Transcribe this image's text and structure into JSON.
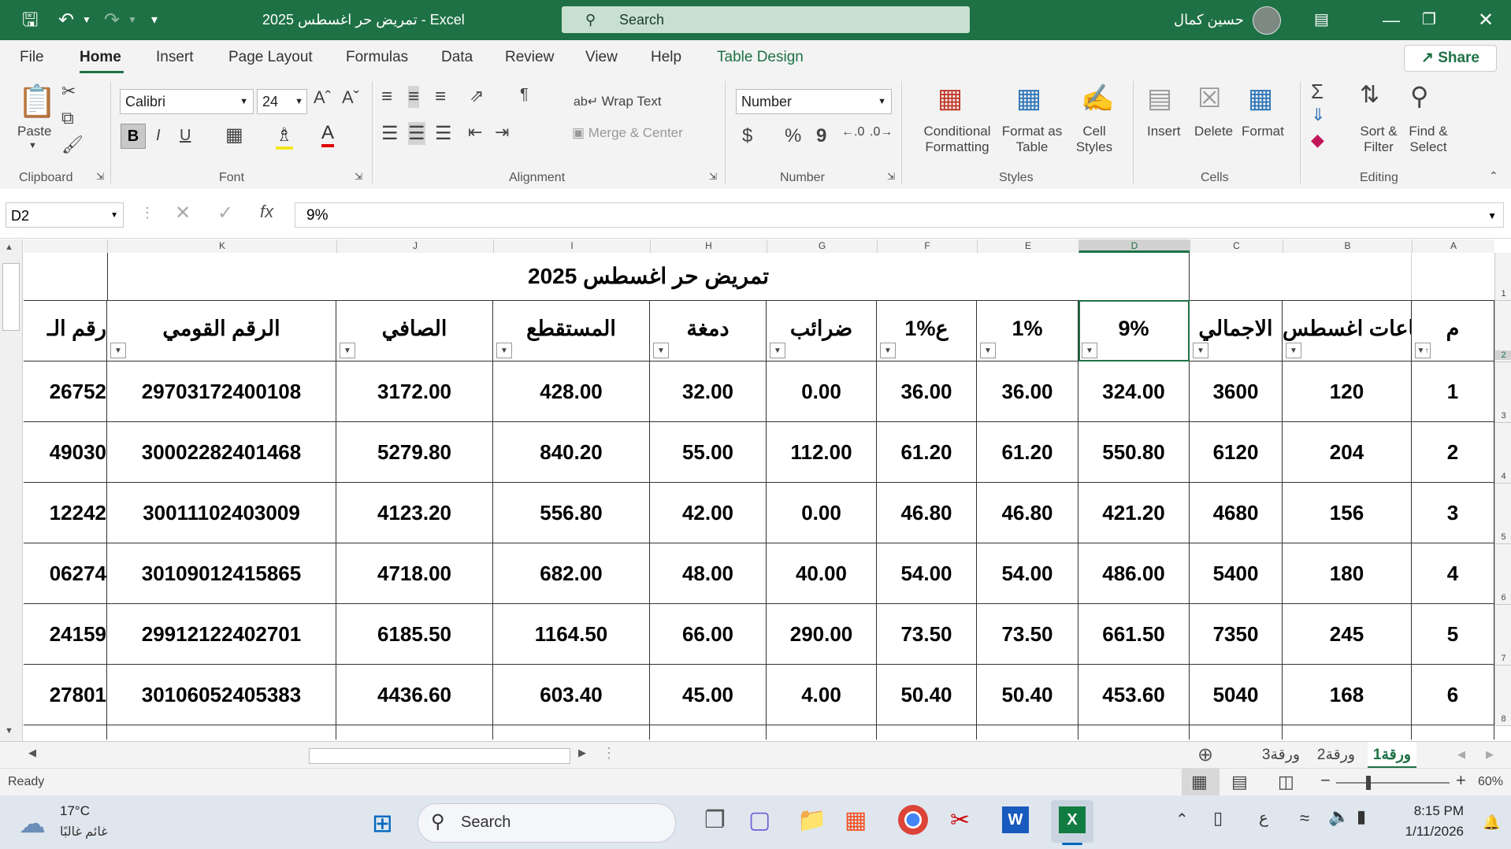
{
  "window": {
    "title": "تمريض حر اغسطس 2025  -  Excel",
    "search_placeholder": "Search",
    "user_name": "حسين كمال"
  },
  "menu": {
    "items": [
      "File",
      "Home",
      "Insert",
      "Page Layout",
      "Formulas",
      "Data",
      "Review",
      "View",
      "Help",
      "Table Design"
    ],
    "share_label": "Share"
  },
  "ribbon": {
    "paste": "Paste",
    "clipboard": "Clipboard",
    "font_name": "Calibri",
    "font_size": "24",
    "font": "Font",
    "bold": "B",
    "italic": "I",
    "underline": "U",
    "wrap_text": "Wrap Text",
    "merge_center": "Merge & Center",
    "alignment": "Alignment",
    "number_format": "Number",
    "currency": "$",
    "percent": "%",
    "comma": "9",
    "number": "Number",
    "conditional_formatting": [
      "Conditional",
      "Formatting"
    ],
    "format_as_table": [
      "Format as",
      "Table"
    ],
    "cell_styles": [
      "Cell",
      "Styles"
    ],
    "styles": "Styles",
    "insert": "Insert",
    "delete": "Delete",
    "format": "Format",
    "cells": "Cells",
    "sort_filter": [
      "Sort &",
      "Filter"
    ],
    "find_select": [
      "Find &",
      "Select"
    ],
    "editing": "Editing"
  },
  "formula_bar": {
    "name_box": "D2",
    "formula": "9%"
  },
  "columns": [
    "A",
    "B",
    "C",
    "D",
    "E",
    "F",
    "G",
    "H",
    "I",
    "J",
    "K"
  ],
  "row_numbers": [
    "1",
    "2",
    "3",
    "4",
    "5",
    "6",
    "7",
    "8"
  ],
  "sheet": {
    "title": "تمريض حر اغسطس 2025",
    "headers": [
      "م",
      "ساعات اغسطس",
      "الاجمالي",
      "9%",
      "1%",
      "1%ع",
      "ضرائب",
      "دمغة",
      "المستقطع",
      "الصافي",
      "الرقم القومي",
      "رقم الـ"
    ],
    "rows": [
      [
        "1",
        "120",
        "3600",
        "324.00",
        "36.00",
        "36.00",
        "0.00",
        "32.00",
        "428.00",
        "3172.00",
        "29703172400108",
        "26752"
      ],
      [
        "2",
        "204",
        "6120",
        "550.80",
        "61.20",
        "61.20",
        "112.00",
        "55.00",
        "840.20",
        "5279.80",
        "30002282401468",
        "49030"
      ],
      [
        "3",
        "156",
        "4680",
        "421.20",
        "46.80",
        "46.80",
        "0.00",
        "42.00",
        "556.80",
        "4123.20",
        "30011102403009",
        "12242"
      ],
      [
        "4",
        "180",
        "5400",
        "486.00",
        "54.00",
        "54.00",
        "40.00",
        "48.00",
        "682.00",
        "4718.00",
        "30109012415865",
        "06274"
      ],
      [
        "5",
        "245",
        "7350",
        "661.50",
        "73.50",
        "73.50",
        "290.00",
        "66.00",
        "1164.50",
        "6185.50",
        "29912122402701",
        "24159"
      ],
      [
        "6",
        "168",
        "5040",
        "453.60",
        "50.40",
        "50.40",
        "4.00",
        "45.00",
        "603.40",
        "4436.60",
        "30106052405383",
        "27801"
      ]
    ]
  },
  "tabs": [
    "ورقة1",
    "ورقة2",
    "ورقة3"
  ],
  "status": {
    "ready": "Ready",
    "zoom": "60%"
  },
  "taskbar": {
    "temperature": "17°C",
    "weather": "غائم غالبًا",
    "search": "Search",
    "lang": "ع",
    "time": "8:15 PM",
    "date": "1/11/2026"
  }
}
